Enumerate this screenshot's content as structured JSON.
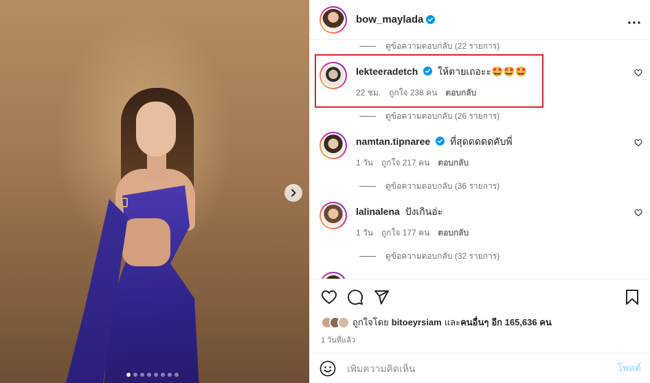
{
  "post": {
    "image_dots": 8,
    "active_dot": 0
  },
  "header": {
    "username": "bow_maylada",
    "verified": true,
    "more_icon": "more-horizontal-icon"
  },
  "comments": {
    "top_replies": "ดูข้อความตอบกลับ (22 รายการ)",
    "items": [
      {
        "username": "lekteeradetch",
        "verified": true,
        "text": "ให้ตายเถอะะ🤩🤩🤩",
        "time": "22 ชม.",
        "likes": "ถูกใจ 238 คน",
        "reply_label": "ตอบกลับ",
        "replies": "ดูข้อความตอบกลับ (26 รายการ)",
        "highlighted": true
      },
      {
        "username": "namtan.tipnaree",
        "verified": true,
        "text": "ที่สุดดดดดคับพี่",
        "time": "1 วัน",
        "likes": "ถูกใจ 217 คน",
        "reply_label": "ตอบกลับ",
        "replies": "ดูข้อความตอบกลับ (36 รายการ)",
        "highlighted": false
      },
      {
        "username": "lalinalena",
        "verified": false,
        "text": "ปังเกินอ่ะ",
        "time": "1 วัน",
        "likes": "ถูกใจ 177 คน",
        "reply_label": "ตอบกลับ",
        "replies": "ดูข้อความตอบกลับ (32 รายการ)",
        "highlighted": false
      }
    ]
  },
  "actions": {
    "liked_by_prefix": "ถูกใจโดย",
    "liked_by_user": "bitoeyrsiam",
    "liked_by_mid": "และ",
    "liked_by_others": "คนอื่นๆ",
    "liked_by_more": "อีก 165,636 คน",
    "time_ago": "1 วันที่แล้ว"
  },
  "composer": {
    "placeholder": "เพิ่มความคิดเห็น",
    "post_label": "โพสต์"
  },
  "colors": {
    "highlight": "#e0202b",
    "verified": "#0095f6",
    "post_button_disabled": "#b2dffc",
    "dress": "#2e2387"
  }
}
